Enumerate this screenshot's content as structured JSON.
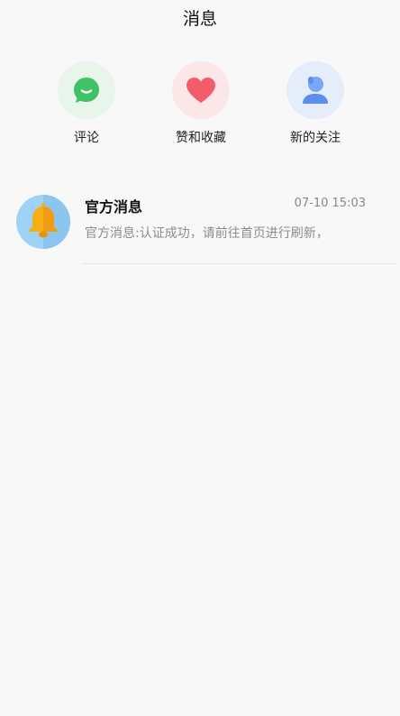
{
  "header": {
    "title": "消息"
  },
  "quick_actions": [
    {
      "label": "评论",
      "icon": "chat-bubble-icon",
      "bg": "#e8f5ea",
      "color": "#3fc266"
    },
    {
      "label": "赞和收藏",
      "icon": "heart-icon",
      "bg": "#fbe7e8",
      "color": "#f25d6a"
    },
    {
      "label": "新的关注",
      "icon": "user-icon",
      "bg": "#e5edfb",
      "color": "#5a8ef0"
    }
  ],
  "messages": [
    {
      "sender": "官方消息",
      "time": "07-10 15:03",
      "preview": "官方消息:认证成功，请前往首页进行刷新，",
      "icon": "bell-icon",
      "avatar_bg": "#9ed3f7",
      "icon_color": "#f6ae12"
    }
  ]
}
